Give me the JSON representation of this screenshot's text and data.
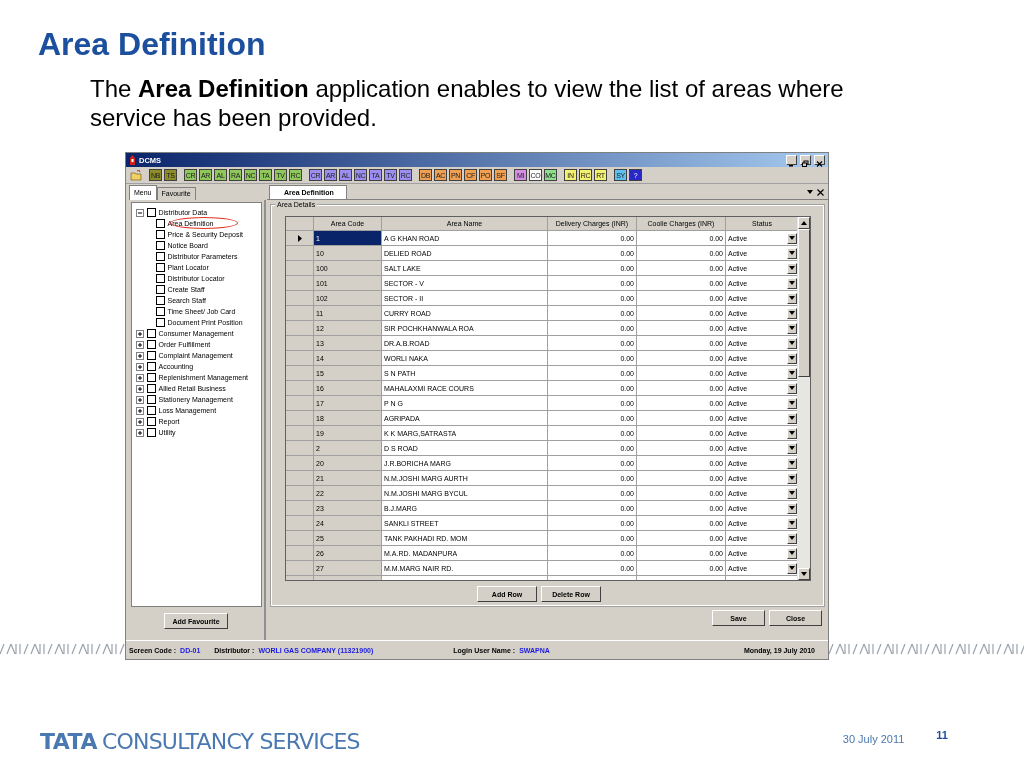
{
  "slide": {
    "title": "Area Definition",
    "text": "The **Area Definition** application enables to view the list of areas where service has been provided."
  },
  "window": {
    "title": "DCMS",
    "toolbar": [
      [
        {
          "label": "NB",
          "color": "#8c8c28"
        },
        {
          "label": "TS",
          "color": "#8c8c28"
        }
      ],
      [
        {
          "label": "CR",
          "color": "#8fc85a"
        },
        {
          "label": "AR",
          "color": "#8fc85a"
        },
        {
          "label": "AL",
          "color": "#8fc85a"
        },
        {
          "label": "RA",
          "color": "#8fc85a"
        },
        {
          "label": "NC",
          "color": "#8fc85a"
        },
        {
          "label": "TA",
          "color": "#8fc85a"
        },
        {
          "label": "TV",
          "color": "#8fc85a"
        },
        {
          "label": "RC",
          "color": "#8fc85a"
        }
      ],
      [
        {
          "label": "CR",
          "color": "#9b8ef0"
        },
        {
          "label": "AR",
          "color": "#9b8ef0"
        },
        {
          "label": "AL",
          "color": "#9b8ef0"
        },
        {
          "label": "NC",
          "color": "#9b8ef0"
        },
        {
          "label": "TA",
          "color": "#9b8ef0"
        },
        {
          "label": "TV",
          "color": "#9b8ef0"
        },
        {
          "label": "RC",
          "color": "#9b8ef0"
        }
      ],
      [
        {
          "label": "DB",
          "color": "#f0a050"
        },
        {
          "label": "AC",
          "color": "#f0a050"
        },
        {
          "label": "PN",
          "color": "#f0a050"
        },
        {
          "label": "CF",
          "color": "#f0a050"
        },
        {
          "label": "PO",
          "color": "#f0a050"
        },
        {
          "label": "SF",
          "color": "#f0a050"
        }
      ],
      [
        {
          "label": "MI",
          "color": "#d48ee4"
        },
        {
          "label": "CO",
          "color": "#ffffff"
        },
        {
          "label": "MC",
          "color": "#8ee08e"
        }
      ],
      [
        {
          "label": "IN",
          "color": "#f4f070"
        },
        {
          "label": "RC",
          "color": "#f4f070"
        },
        {
          "label": "RT",
          "color": "#f4f070"
        }
      ],
      [
        {
          "label": "SY",
          "color": "#5ec0f0"
        },
        {
          "label": "?",
          "color": "#2828c8"
        }
      ]
    ],
    "left_tabs": [
      {
        "label": "Menu",
        "selected": true
      },
      {
        "label": "Favourite",
        "selected": false
      }
    ],
    "tree": [
      {
        "label": "Distributor Data",
        "checked": false,
        "expanded": true,
        "children": [
          {
            "label": "Area Definition",
            "checked": false,
            "circled": true
          },
          {
            "label": "Price & Security Deposit",
            "checked": false,
            "circled": false
          },
          {
            "label": "Notice Board",
            "checked": false,
            "circled": false
          },
          {
            "label": "Distributor Parameters",
            "checked": false,
            "circled": false
          },
          {
            "label": "Plant Locator",
            "checked": false,
            "circled": false
          },
          {
            "label": "Distributor Locator",
            "checked": false,
            "circled": false
          },
          {
            "label": "Create Staff",
            "checked": false,
            "circled": false
          },
          {
            "label": "Search Staff",
            "checked": false,
            "circled": false
          },
          {
            "label": "Time Sheet/ Job Card",
            "checked": false,
            "circled": false
          },
          {
            "label": "Document Print Position",
            "checked": false,
            "circled": false
          }
        ]
      },
      {
        "label": "Consumer Management",
        "checked": false,
        "expanded": false
      },
      {
        "label": "Order Fulfillment",
        "checked": false,
        "expanded": false
      },
      {
        "label": "Complaint Management",
        "checked": false,
        "expanded": false
      },
      {
        "label": "Accounting",
        "checked": false,
        "expanded": false
      },
      {
        "label": "Replenishment Management",
        "checked": false,
        "expanded": false
      },
      {
        "label": "Allied Retail Business",
        "checked": false,
        "expanded": false
      },
      {
        "label": "Stationery Management",
        "checked": false,
        "expanded": false
      },
      {
        "label": "Loss Management",
        "checked": false,
        "expanded": false
      },
      {
        "label": "Report",
        "checked": false,
        "expanded": false
      },
      {
        "label": "Utility",
        "checked": false,
        "expanded": false
      }
    ],
    "add_favourite": "Add Favourite",
    "doc_tab": {
      "label": "Area Definition",
      "selected": true
    },
    "group_title": "Area Details",
    "columns": [
      "Area Code",
      "Area Name",
      "Delivery Charges (INR)",
      "Coolie Charges (INR)",
      "Status"
    ],
    "rows": [
      {
        "code": "1",
        "name": "A G KHAN ROAD",
        "delivery": "0.00",
        "coolie": "0.00",
        "status": "Active",
        "selected": true
      },
      {
        "code": "10",
        "name": "DELIED ROAD",
        "delivery": "0.00",
        "coolie": "0.00",
        "status": "Active",
        "selected": false
      },
      {
        "code": "100",
        "name": "SALT LAKE",
        "delivery": "0.00",
        "coolie": "0.00",
        "status": "Active",
        "selected": false
      },
      {
        "code": "101",
        "name": "SECTOR - V",
        "delivery": "0.00",
        "coolie": "0.00",
        "status": "Active",
        "selected": false
      },
      {
        "code": "102",
        "name": "SECTOR - II",
        "delivery": "0.00",
        "coolie": "0.00",
        "status": "Active",
        "selected": false
      },
      {
        "code": "11",
        "name": "CURRY ROAD",
        "delivery": "0.00",
        "coolie": "0.00",
        "status": "Active",
        "selected": false
      },
      {
        "code": "12",
        "name": "SIR POCHKHANWALA ROA",
        "delivery": "0.00",
        "coolie": "0.00",
        "status": "Active",
        "selected": false
      },
      {
        "code": "13",
        "name": "DR.A.B.ROAD",
        "delivery": "0.00",
        "coolie": "0.00",
        "status": "Active",
        "selected": false
      },
      {
        "code": "14",
        "name": "WORLI NAKA",
        "delivery": "0.00",
        "coolie": "0.00",
        "status": "Active",
        "selected": false
      },
      {
        "code": "15",
        "name": "S N PATH",
        "delivery": "0.00",
        "coolie": "0.00",
        "status": "Active",
        "selected": false
      },
      {
        "code": "16",
        "name": "MAHALAXMI RACE COURS",
        "delivery": "0.00",
        "coolie": "0.00",
        "status": "Active",
        "selected": false
      },
      {
        "code": "17",
        "name": "P N G",
        "delivery": "0.00",
        "coolie": "0.00",
        "status": "Active",
        "selected": false
      },
      {
        "code": "18",
        "name": "AGRIPADA",
        "delivery": "0.00",
        "coolie": "0.00",
        "status": "Active",
        "selected": false
      },
      {
        "code": "19",
        "name": "K K MARG,SATRASTA",
        "delivery": "0.00",
        "coolie": "0.00",
        "status": "Active",
        "selected": false
      },
      {
        "code": "2",
        "name": "D S ROAD",
        "delivery": "0.00",
        "coolie": "0.00",
        "status": "Active",
        "selected": false
      },
      {
        "code": "20",
        "name": "J.R.BORICHA MARG",
        "delivery": "0.00",
        "coolie": "0.00",
        "status": "Active",
        "selected": false
      },
      {
        "code": "21",
        "name": "N.M.JOSHI MARG AURTH",
        "delivery": "0.00",
        "coolie": "0.00",
        "status": "Active",
        "selected": false
      },
      {
        "code": "22",
        "name": "N.M.JOSHI MARG BYCUL",
        "delivery": "0.00",
        "coolie": "0.00",
        "status": "Active",
        "selected": false
      },
      {
        "code": "23",
        "name": "B.J.MARG",
        "delivery": "0.00",
        "coolie": "0.00",
        "status": "Active",
        "selected": false
      },
      {
        "code": "24",
        "name": "SANKLI STREET",
        "delivery": "0.00",
        "coolie": "0.00",
        "status": "Active",
        "selected": false
      },
      {
        "code": "25",
        "name": "TANK PAKHADI RD. MOM",
        "delivery": "0.00",
        "coolie": "0.00",
        "status": "Active",
        "selected": false
      },
      {
        "code": "26",
        "name": "M.A.RD. MADANPURA",
        "delivery": "0.00",
        "coolie": "0.00",
        "status": "Active",
        "selected": false
      },
      {
        "code": "27",
        "name": "M.M.MARG NAIR RD.",
        "delivery": "0.00",
        "coolie": "0.00",
        "status": "Active",
        "selected": false
      }
    ],
    "grid_buttons": [
      "Add Row",
      "Delete Row"
    ],
    "dialog_buttons": [
      "Save",
      "Close"
    ],
    "status_bar": [
      {
        "label": "Screen Code :",
        "value": "DD-01"
      },
      {
        "label": "Distributor :",
        "value": "WORLI GAS COMPANY (11321900)"
      },
      {
        "label": "Login User Name :",
        "value": "SWAPNA"
      }
    ],
    "status_date": "Monday, 19 July 2010"
  },
  "footer": {
    "logo_mark": "TATA",
    "logo_text": "CONSULTANCY SERVICES",
    "date": "30 July 2011",
    "page": "11"
  }
}
